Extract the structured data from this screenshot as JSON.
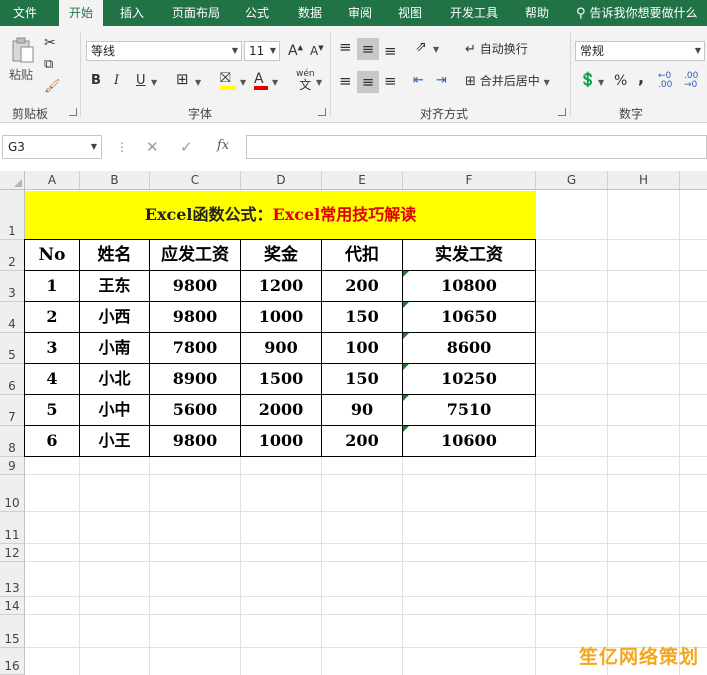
{
  "tabs": [
    {
      "label": "文件"
    },
    {
      "label": "开始"
    },
    {
      "label": "插入"
    },
    {
      "label": "页面布局"
    },
    {
      "label": "公式"
    },
    {
      "label": "数据"
    },
    {
      "label": "审阅"
    },
    {
      "label": "视图"
    },
    {
      "label": "开发工具"
    },
    {
      "label": "帮助"
    }
  ],
  "tell_me": "告诉我你想要做什么",
  "clipboard": {
    "paste_label": "粘贴",
    "group_label": "剪贴板"
  },
  "font": {
    "name": "等线",
    "size": "11",
    "group_label": "字体",
    "bold": "B",
    "italic": "I",
    "underline": "U",
    "grow": "A",
    "shrink": "A",
    "color_label": "A",
    "wen": "wén"
  },
  "alignment": {
    "wrap_label": "自动换行",
    "merge_label": "合并后居中",
    "group_label": "对齐方式"
  },
  "number": {
    "format": "常规",
    "group_label": "数字",
    "percent": "%",
    "comma": ","
  },
  "namebox": "G3",
  "fx_label": "fx",
  "columns": [
    "A",
    "B",
    "C",
    "D",
    "E",
    "F",
    "G",
    "H"
  ],
  "rows": [
    "1",
    "2",
    "3",
    "4",
    "5",
    "6",
    "7",
    "8",
    "9",
    "10",
    "11",
    "12",
    "13",
    "14",
    "15",
    "16"
  ],
  "sheet": {
    "title_part1": "Excel函数公式：",
    "title_part2": "Excel常用技巧解读",
    "headers": [
      "No",
      "姓名",
      "应发工资",
      "奖金",
      "代扣",
      "实发工资"
    ],
    "rows": [
      [
        "1",
        "王东",
        "9800",
        "1200",
        "200",
        "10800"
      ],
      [
        "2",
        "小西",
        "9800",
        "1000",
        "150",
        "10650"
      ],
      [
        "3",
        "小南",
        "7800",
        "900",
        "100",
        "8600"
      ],
      [
        "4",
        "小北",
        "8900",
        "1500",
        "150",
        "10250"
      ],
      [
        "5",
        "小中",
        "5600",
        "2000",
        "90",
        "7510"
      ],
      [
        "6",
        "小王",
        "9800",
        "1000",
        "200",
        "10600"
      ]
    ]
  },
  "watermark": "笙亿网络策划",
  "colors": {
    "excel_green": "#217346",
    "title_fill": "#ffff00",
    "title_red": "#e00000",
    "watermark": "#f2a71c"
  }
}
